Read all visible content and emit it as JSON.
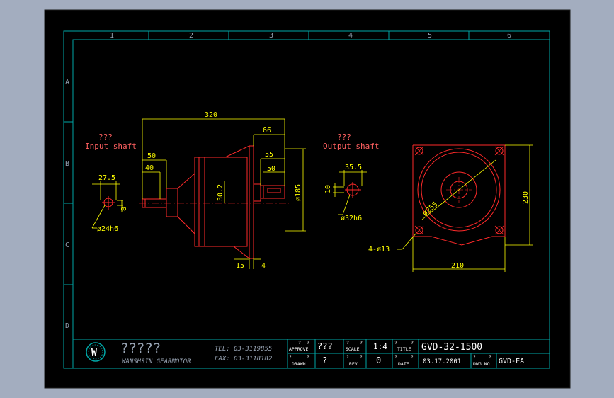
{
  "colors": {
    "background": "#a3adbf",
    "sheet": "#000000",
    "frame": "#00a6a6",
    "geometry": "#ff2a2a",
    "dimension": "#ffff00",
    "title_text": "#ffffff",
    "grid_label": "#8fa0b0"
  },
  "grid": {
    "columns": [
      "1",
      "2",
      "3",
      "4",
      "5",
      "6"
    ],
    "rows": [
      "A",
      "B",
      "C",
      "D"
    ]
  },
  "views": {
    "input_shaft": {
      "caption_top": "???",
      "caption": "Input shaft",
      "dim_width": "27.5",
      "dim_key": "8",
      "diameter": "ø24h6"
    },
    "output_shaft": {
      "caption_top": "???",
      "caption": "Output shaft",
      "dim_width": "35.5",
      "dim_key": "10",
      "diameter": "ø32h6"
    },
    "side_view": {
      "overall_length": "320",
      "flange_length": "66",
      "shaft_55": "55",
      "shaft_50_right": "50",
      "input_50": "50",
      "input_40": "40",
      "center_height": "30.2",
      "flange_diameter": "ø185",
      "flange_thickness": "15",
      "spigot": "4"
    },
    "front_view": {
      "pcd": "ø255",
      "height": "230",
      "width": "210",
      "holes": "4-ø13"
    }
  },
  "title_block": {
    "logo_letter": "W",
    "company_native": "?????",
    "company": "WANSHSIN GEARMOTOR",
    "tel": "TEL: 03-3119855",
    "fax": "FAX: 03-3118182",
    "approve_label": "APPROVE",
    "approve_value": "???",
    "drawn_label": "DRAWN",
    "drawn_value": "?",
    "scale_label": "SCALE",
    "scale_value": "1:4",
    "rev_label": "REV",
    "rev_value": "0",
    "title_label": "TITLE",
    "title_value": "GVD-32-1500",
    "date_label": "DATE",
    "date_value": "03.17.2001",
    "dwg_label": "DWG NO",
    "dwg_value": "GVD-EA",
    "q": "?"
  }
}
